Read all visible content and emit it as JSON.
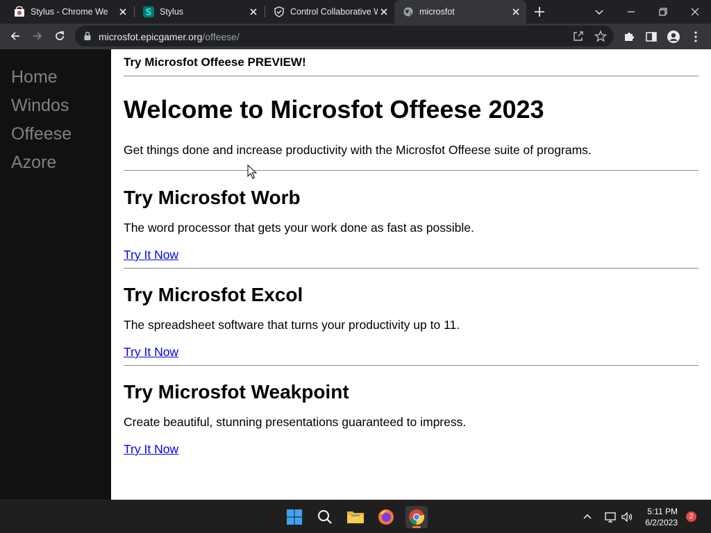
{
  "browser": {
    "tabs": [
      {
        "title": "Stylus - Chrome Web Store",
        "active": false
      },
      {
        "title": "Stylus",
        "active": false
      },
      {
        "title": "Control Collaborative Whiteboard",
        "active": false
      },
      {
        "title": "microsfot",
        "active": true
      }
    ],
    "url": {
      "host": "microsfot.epicgamer.org",
      "path": "/offeese/"
    }
  },
  "sidebar": {
    "items": [
      {
        "label": "Home"
      },
      {
        "label": "Windos"
      },
      {
        "label": "Offeese"
      },
      {
        "label": "Azore"
      }
    ]
  },
  "page": {
    "preview_banner": "Try Microsfot Offeese PREVIEW!",
    "hero_title": "Welcome to Microsfot Offeese 2023",
    "hero_desc": "Get things done and increase productivity with the Microsfot Offeese suite of programs.",
    "sections": [
      {
        "title": "Try Microsfot Worb",
        "desc": "The word processor that gets your work done as fast as possible.",
        "link": "Try It Now"
      },
      {
        "title": "Try Microsfot Excol",
        "desc": "The spreadsheet software that turns your productivity up to 11.",
        "link": "Try It Now"
      },
      {
        "title": "Try Microsfot Weakpoint",
        "desc": "Create beautiful, stunning presentations guaranteed to impress.",
        "link": "Try It Now"
      }
    ]
  },
  "taskbar": {
    "time": "5:11 PM",
    "date": "6/2/2023",
    "notification_count": "2"
  },
  "colors": {
    "sidebar_bg": "#111111",
    "sidebar_link": "#818181",
    "link": "#0000ee",
    "chrome_dark": "#202124",
    "chrome_toolbar": "#35363a"
  }
}
